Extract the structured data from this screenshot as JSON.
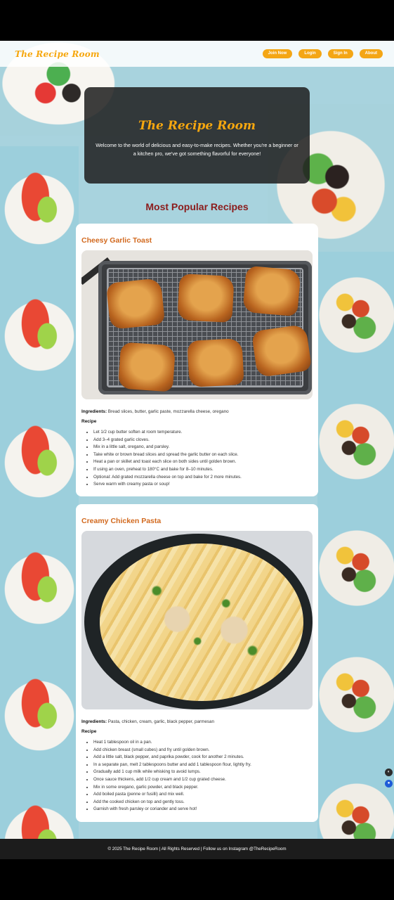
{
  "nav": {
    "logo": "The Recipe Room",
    "links": [
      "Join Now",
      "Login",
      "Sign In",
      "About"
    ]
  },
  "hero": {
    "title": "The Recipe Room",
    "text": "Welcome to the world of delicious and easy-to-make recipes. Whether you're a beginner or a kitchen pro, we've got something flavorful for everyone!"
  },
  "section_title": "Most Popular Recipes",
  "recipes": [
    {
      "title": "Cheesy Garlic Toast",
      "ingredients_label": "Ingredients:",
      "ingredients": "Bread slices, butter, garlic paste, mozzarella cheese, oregano",
      "recipe_label": "Recipe",
      "steps": [
        "Let 1/2 cup butter soften at room temperature.",
        "Add 3–4 grated garlic cloves.",
        "Mix in a little salt, oregano, and parsley.",
        "Take white or brown bread slices and spread the garlic butter on each slice.",
        "Heat a pan or skillet and toast each slice on both sides until golden brown.",
        "If using an oven, preheat to 180°C and bake for 8–10 minutes.",
        "Optional: Add grated mozzarella cheese on top and bake for 2 more minutes.",
        "Serve warm with creamy pasta or soup!"
      ]
    },
    {
      "title": "Creamy Chicken Pasta",
      "ingredients_label": "Ingredients:",
      "ingredients": "Pasta, chicken, cream, garlic, black pepper, parmesan",
      "recipe_label": "Recipe",
      "steps": [
        "Heat 1 tablespoon oil in a pan.",
        "Add chicken breast (small cubes) and fry until golden brown.",
        "Add a little salt, black pepper, and paprika powder, cook for another 2 minutes.",
        "In a separate pan, melt 2 tablespoons butter and add 1 tablespoon flour, lightly fry.",
        "Gradually add 1 cup milk while whisking to avoid lumps.",
        "Once sauce thickens, add 1/2 cup cream and 1/2 cup grated cheese.",
        "Mix in some oregano, garlic powder, and black pepper.",
        "Add boiled pasta (penne or fusilli) and mix well.",
        "Add the cooked chicken on top and gently toss.",
        "Garnish with fresh parsley or coriander and serve hot!"
      ]
    }
  ],
  "footer": "© 2025 The Recipe Room | All Rights Reserved | Follow us on Instagram @TheRecipeRoom",
  "colors": {
    "accent": "#f4a615",
    "recipe_title": "#d2691e",
    "section_title": "#8b1c1c",
    "footer_bg": "#1c1c1c"
  }
}
